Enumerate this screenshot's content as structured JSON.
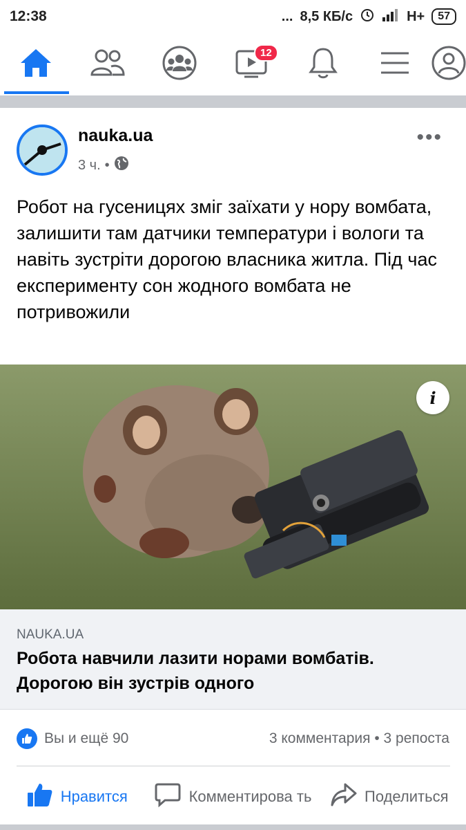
{
  "status_bar": {
    "time": "12:38",
    "dots": "...",
    "speed": "8,5 КБ/с",
    "network": "H+",
    "battery": "57"
  },
  "nav": {
    "video_badge": "12"
  },
  "post": {
    "page_name": "nauka.ua",
    "time": "3 ч.",
    "dot": "•",
    "text": "Робот на гусеницях зміг заїхати у нору вомбата, залишити там датчики температури і вологи та навіть зустріти дорогою власника житла. Під час експерименту сон жодного вомбата не потривожили",
    "info_label": "i",
    "link": {
      "domain": "NAUKA.UA",
      "title": "Робота навчили лазити норами вомбатів. Дорогою він зустрів одного"
    },
    "reactions": {
      "likes_text": "Вы и ещё 90",
      "comments_shares": "3 комментария • 3 репоста"
    },
    "actions": {
      "like": "Нравится",
      "comment": "Комментирова ть",
      "share": "Поделиться"
    }
  },
  "colors": {
    "accent": "#1877f2",
    "badge": "#f02849",
    "secondary_text": "#65676b"
  }
}
